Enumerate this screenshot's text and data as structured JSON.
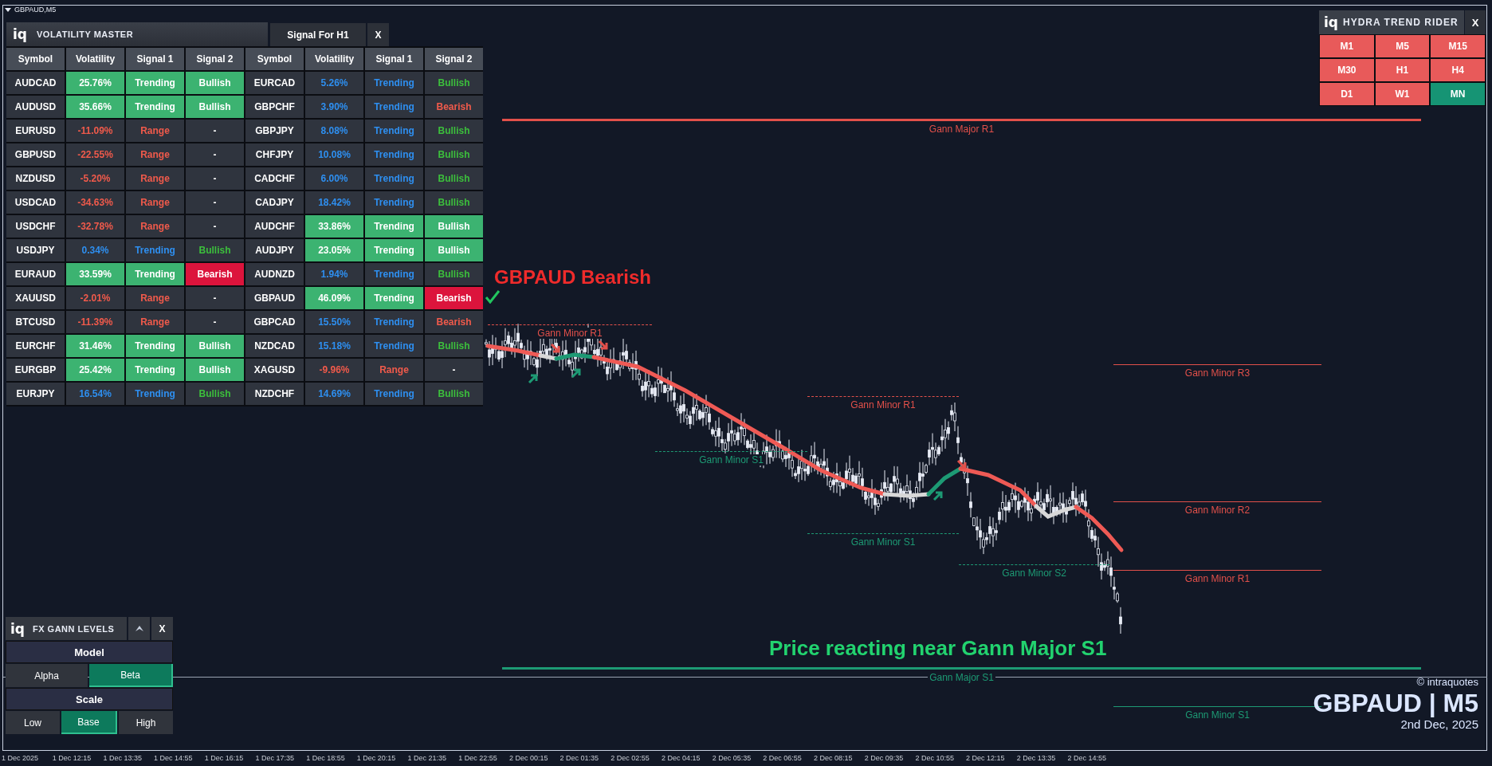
{
  "chart_title": "GBPAUD,M5",
  "volatility_master": {
    "logo": "iq",
    "title": "VOLATILITY MASTER",
    "tab": "Signal For H1",
    "close": "X",
    "columns": [
      "Symbol",
      "Volatility",
      "Signal 1",
      "Signal 2",
      "Symbol",
      "Volatility",
      "Signal 1",
      "Signal 2"
    ],
    "rows": [
      [
        {
          "text": "AUDCAD",
          "kind": "plain"
        },
        {
          "text": "25.76%",
          "kind": "fill-green"
        },
        {
          "text": "Trending",
          "kind": "fill-green"
        },
        {
          "text": "Bullish",
          "kind": "fill-green"
        },
        {
          "text": "EURCAD",
          "kind": "plain"
        },
        {
          "text": "5.26%",
          "kind": "blue"
        },
        {
          "text": "Trending",
          "kind": "blue"
        },
        {
          "text": "Bullish",
          "kind": "green"
        }
      ],
      [
        {
          "text": "AUDUSD",
          "kind": "plain"
        },
        {
          "text": "35.66%",
          "kind": "fill-green"
        },
        {
          "text": "Trending",
          "kind": "fill-green"
        },
        {
          "text": "Bullish",
          "kind": "fill-green"
        },
        {
          "text": "GBPCHF",
          "kind": "plain"
        },
        {
          "text": "3.90%",
          "kind": "blue"
        },
        {
          "text": "Trending",
          "kind": "blue"
        },
        {
          "text": "Bearish",
          "kind": "red"
        }
      ],
      [
        {
          "text": "EURUSD",
          "kind": "plain"
        },
        {
          "text": "-11.09%",
          "kind": "red"
        },
        {
          "text": "Range",
          "kind": "red"
        },
        {
          "text": "-",
          "kind": "plain"
        },
        {
          "text": "GBPJPY",
          "kind": "plain"
        },
        {
          "text": "8.08%",
          "kind": "blue"
        },
        {
          "text": "Trending",
          "kind": "blue"
        },
        {
          "text": "Bullish",
          "kind": "green"
        }
      ],
      [
        {
          "text": "GBPUSD",
          "kind": "plain"
        },
        {
          "text": "-22.55%",
          "kind": "red"
        },
        {
          "text": "Range",
          "kind": "red"
        },
        {
          "text": "-",
          "kind": "plain"
        },
        {
          "text": "CHFJPY",
          "kind": "plain"
        },
        {
          "text": "10.08%",
          "kind": "blue"
        },
        {
          "text": "Trending",
          "kind": "blue"
        },
        {
          "text": "Bullish",
          "kind": "green"
        }
      ],
      [
        {
          "text": "NZDUSD",
          "kind": "plain"
        },
        {
          "text": "-5.20%",
          "kind": "red"
        },
        {
          "text": "Range",
          "kind": "red"
        },
        {
          "text": "-",
          "kind": "plain"
        },
        {
          "text": "CADCHF",
          "kind": "plain"
        },
        {
          "text": "6.00%",
          "kind": "blue"
        },
        {
          "text": "Trending",
          "kind": "blue"
        },
        {
          "text": "Bullish",
          "kind": "green"
        }
      ],
      [
        {
          "text": "USDCAD",
          "kind": "plain"
        },
        {
          "text": "-34.63%",
          "kind": "red"
        },
        {
          "text": "Range",
          "kind": "red"
        },
        {
          "text": "-",
          "kind": "plain"
        },
        {
          "text": "CADJPY",
          "kind": "plain"
        },
        {
          "text": "18.42%",
          "kind": "blue"
        },
        {
          "text": "Trending",
          "kind": "blue"
        },
        {
          "text": "Bullish",
          "kind": "green"
        }
      ],
      [
        {
          "text": "USDCHF",
          "kind": "plain"
        },
        {
          "text": "-32.78%",
          "kind": "red"
        },
        {
          "text": "Range",
          "kind": "red"
        },
        {
          "text": "-",
          "kind": "plain"
        },
        {
          "text": "AUDCHF",
          "kind": "plain"
        },
        {
          "text": "33.86%",
          "kind": "fill-green"
        },
        {
          "text": "Trending",
          "kind": "fill-green"
        },
        {
          "text": "Bullish",
          "kind": "fill-green"
        }
      ],
      [
        {
          "text": "USDJPY",
          "kind": "plain"
        },
        {
          "text": "0.34%",
          "kind": "blue"
        },
        {
          "text": "Trending",
          "kind": "blue"
        },
        {
          "text": "Bullish",
          "kind": "green"
        },
        {
          "text": "AUDJPY",
          "kind": "plain"
        },
        {
          "text": "23.05%",
          "kind": "fill-green"
        },
        {
          "text": "Trending",
          "kind": "fill-green"
        },
        {
          "text": "Bullish",
          "kind": "fill-green"
        }
      ],
      [
        {
          "text": "EURAUD",
          "kind": "plain"
        },
        {
          "text": "33.59%",
          "kind": "fill-green"
        },
        {
          "text": "Trending",
          "kind": "fill-green"
        },
        {
          "text": "Bearish",
          "kind": "fill-red"
        },
        {
          "text": "AUDNZD",
          "kind": "plain"
        },
        {
          "text": "1.94%",
          "kind": "blue"
        },
        {
          "text": "Trending",
          "kind": "blue"
        },
        {
          "text": "Bullish",
          "kind": "green"
        }
      ],
      [
        {
          "text": "XAUUSD",
          "kind": "plain"
        },
        {
          "text": "-2.01%",
          "kind": "red"
        },
        {
          "text": "Range",
          "kind": "red"
        },
        {
          "text": "-",
          "kind": "plain"
        },
        {
          "text": "GBPAUD",
          "kind": "plain"
        },
        {
          "text": "46.09%",
          "kind": "fill-green"
        },
        {
          "text": "Trending",
          "kind": "fill-green"
        },
        {
          "text": "Bearish",
          "kind": "fill-red"
        }
      ],
      [
        {
          "text": "BTCUSD",
          "kind": "plain"
        },
        {
          "text": "-11.39%",
          "kind": "red"
        },
        {
          "text": "Range",
          "kind": "red"
        },
        {
          "text": "-",
          "kind": "plain"
        },
        {
          "text": "GBPCAD",
          "kind": "plain"
        },
        {
          "text": "15.50%",
          "kind": "blue"
        },
        {
          "text": "Trending",
          "kind": "blue"
        },
        {
          "text": "Bearish",
          "kind": "red"
        }
      ],
      [
        {
          "text": "EURCHF",
          "kind": "plain"
        },
        {
          "text": "31.46%",
          "kind": "fill-green"
        },
        {
          "text": "Trending",
          "kind": "fill-green"
        },
        {
          "text": "Bullish",
          "kind": "fill-green"
        },
        {
          "text": "NZDCAD",
          "kind": "plain"
        },
        {
          "text": "15.18%",
          "kind": "blue"
        },
        {
          "text": "Trending",
          "kind": "blue"
        },
        {
          "text": "Bullish",
          "kind": "green"
        }
      ],
      [
        {
          "text": "EURGBP",
          "kind": "plain"
        },
        {
          "text": "25.42%",
          "kind": "fill-green"
        },
        {
          "text": "Trending",
          "kind": "fill-green"
        },
        {
          "text": "Bullish",
          "kind": "fill-green"
        },
        {
          "text": "XAGUSD",
          "kind": "plain"
        },
        {
          "text": "-9.96%",
          "kind": "red"
        },
        {
          "text": "Range",
          "kind": "red"
        },
        {
          "text": "-",
          "kind": "plain"
        }
      ],
      [
        {
          "text": "EURJPY",
          "kind": "plain"
        },
        {
          "text": "16.54%",
          "kind": "blue"
        },
        {
          "text": "Trending",
          "kind": "blue"
        },
        {
          "text": "Bullish",
          "kind": "green"
        },
        {
          "text": "NZDCHF",
          "kind": "plain"
        },
        {
          "text": "14.69%",
          "kind": "blue"
        },
        {
          "text": "Trending",
          "kind": "blue"
        },
        {
          "text": "Bullish",
          "kind": "green"
        }
      ]
    ]
  },
  "hydra_trend_rider": {
    "logo": "iq",
    "title": "HYDRA TREND RIDER",
    "close": "X",
    "timeframes": [
      {
        "label": "M1",
        "kind": "bear"
      },
      {
        "label": "M5",
        "kind": "bear"
      },
      {
        "label": "M15",
        "kind": "bear"
      },
      {
        "label": "M30",
        "kind": "bear"
      },
      {
        "label": "H1",
        "kind": "bear"
      },
      {
        "label": "H4",
        "kind": "bear"
      },
      {
        "label": "D1",
        "kind": "bear"
      },
      {
        "label": "W1",
        "kind": "bear"
      },
      {
        "label": "MN",
        "kind": "bull"
      }
    ]
  },
  "fx_gann_levels": {
    "logo": "iq",
    "title": "FX GANN LEVELS",
    "close": "X",
    "sections": [
      {
        "heading": "Model",
        "options": [
          {
            "label": "Alpha",
            "selected": false
          },
          {
            "label": "Beta",
            "selected": true
          }
        ]
      },
      {
        "heading": "Scale",
        "options": [
          {
            "label": "Low",
            "selected": false
          },
          {
            "label": "Base",
            "selected": true
          },
          {
            "label": "High",
            "selected": false
          }
        ]
      }
    ]
  },
  "levels": [
    {
      "label": "Gann Major R1",
      "kind": "resistance"
    },
    {
      "label": "Gann Minor R1",
      "kind": "resistance"
    },
    {
      "label": "Gann Minor R3",
      "kind": "resistance"
    },
    {
      "label": "Gann Minor R1",
      "kind": "resistance"
    },
    {
      "label": "Gann Minor S1",
      "kind": "support"
    },
    {
      "label": "Gann Minor R2",
      "kind": "resistance"
    },
    {
      "label": "Gann Minor S1",
      "kind": "support"
    },
    {
      "label": "Gann Minor S2",
      "kind": "support"
    },
    {
      "label": "Gann Minor R1",
      "kind": "resistance"
    },
    {
      "label": "Gann Major S1",
      "kind": "support"
    },
    {
      "label": "Gann Minor S1",
      "kind": "support"
    }
  ],
  "annotations": [
    {
      "text": "GBPAUD Bearish",
      "kind": "bearish"
    },
    {
      "text": "Price reacting near Gann Major S1",
      "kind": "bullish"
    }
  ],
  "branding": {
    "copyright": "© intraquotes",
    "symbol": "GBPAUD | M5",
    "date": "2nd Dec, 2025"
  },
  "time_axis": [
    "1 Dec 2025",
    "1 Dec 12:15",
    "1 Dec 13:35",
    "1 Dec 14:55",
    "1 Dec 16:15",
    "1 Dec 17:35",
    "1 Dec 18:55",
    "1 Dec 20:15",
    "1 Dec 21:35",
    "1 Dec 22:55",
    "2 Dec 00:15",
    "2 Dec 01:35",
    "2 Dec 02:55",
    "2 Dec 04:15",
    "2 Dec 05:35",
    "2 Dec 06:55",
    "2 Dec 08:15",
    "2 Dec 09:35",
    "2 Dec 10:55",
    "2 Dec 12:15",
    "2 Dec 13:35",
    "2 Dec 14:55"
  ]
}
